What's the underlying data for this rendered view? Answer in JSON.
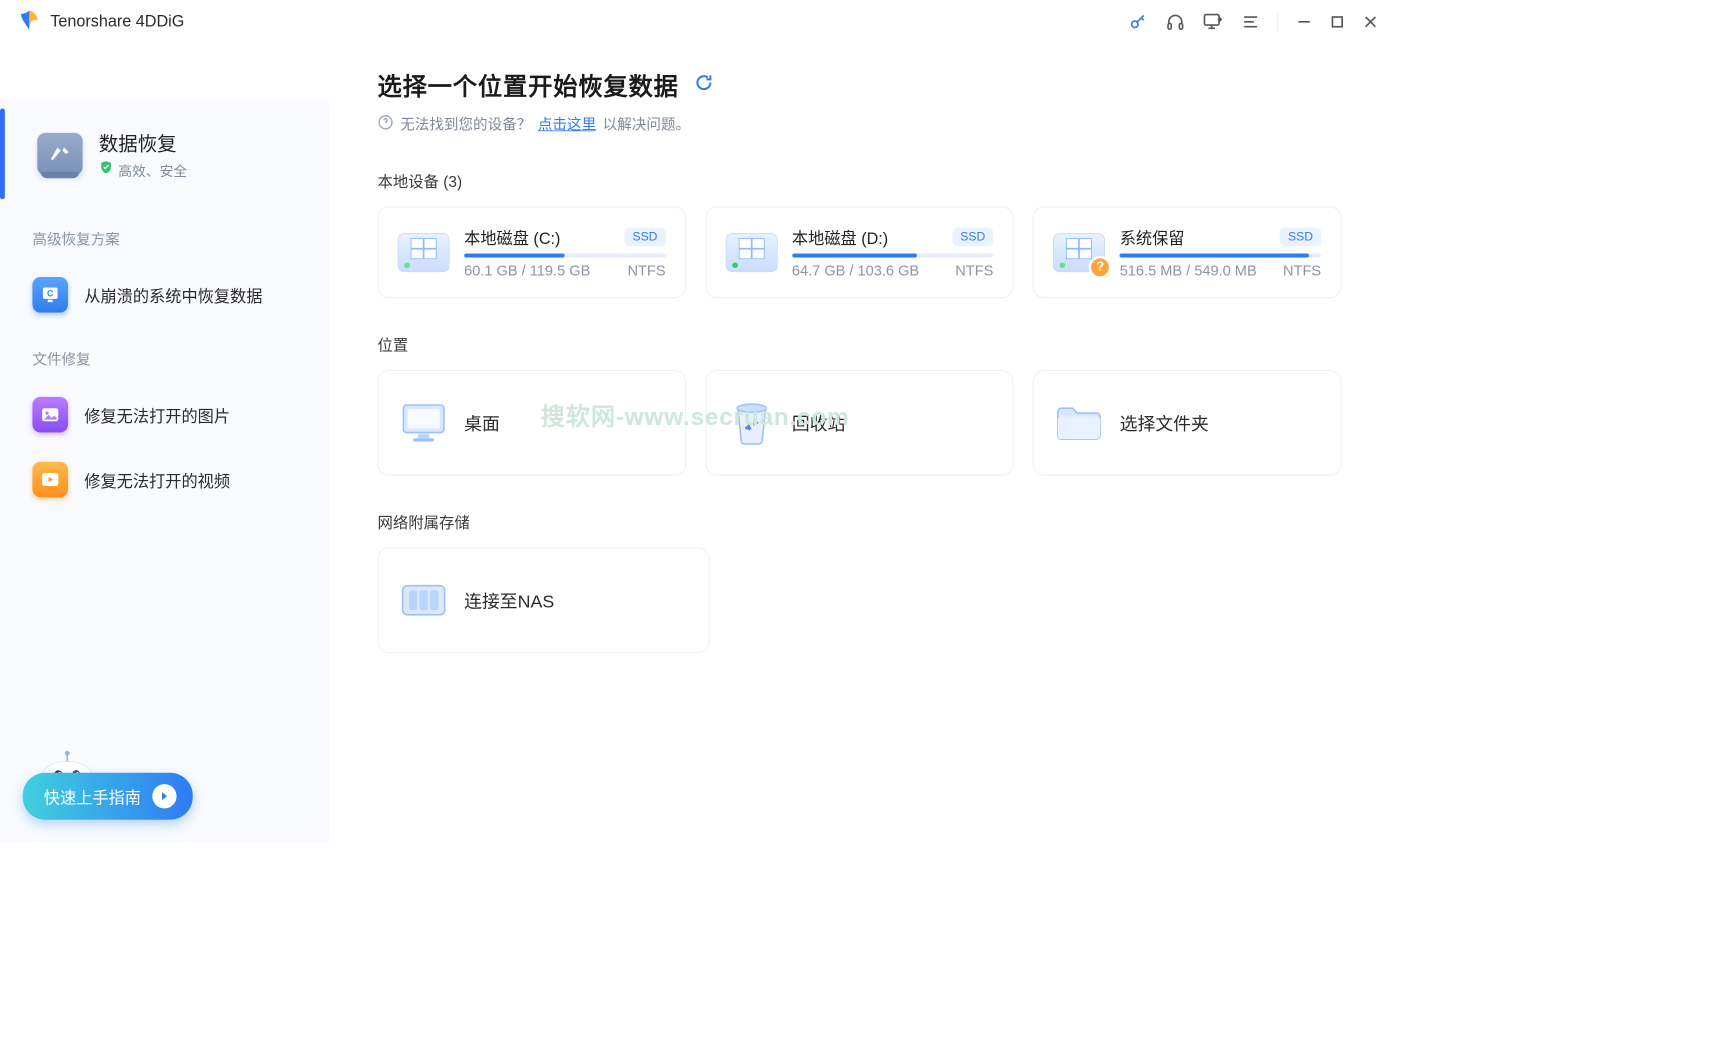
{
  "app": {
    "title": "Tenorshare 4DDiG"
  },
  "sidebar": {
    "primary": {
      "title": "数据恢复",
      "subtitle": "高效、安全"
    },
    "sections": {
      "advanced_label": "高级恢复方案",
      "crash_recovery": "从崩溃的系统中恢复数据",
      "file_repair_label": "文件修复",
      "repair_photo": "修复无法打开的图片",
      "repair_video": "修复无法打开的视频"
    },
    "guide_button": "快速上手指南"
  },
  "main": {
    "title": "选择一个位置开始恢复数据",
    "help_prefix": "无法找到您的设备？",
    "help_link": "点击这里",
    "help_suffix": "以解决问题。",
    "local_label": "本地设备 (3)",
    "disks": [
      {
        "name": "本地磁盘 (C:)",
        "badge": "SSD",
        "used_pct": 50,
        "usage": "60.1 GB / 119.5 GB",
        "fs": "NTFS",
        "warn": false
      },
      {
        "name": "本地磁盘 (D:)",
        "badge": "SSD",
        "used_pct": 62,
        "usage": "64.7 GB / 103.6 GB",
        "fs": "NTFS",
        "warn": false
      },
      {
        "name": "系统保留",
        "badge": "SSD",
        "used_pct": 94,
        "usage": "516.5 MB / 549.0 MB",
        "fs": "NTFS",
        "warn": true
      }
    ],
    "pos_label": "位置",
    "locations": {
      "desktop": "桌面",
      "recycle": "回收站",
      "choose_folder": "选择文件夹"
    },
    "nas_label": "网络附属存储",
    "nas_connect": "连接至NAS"
  },
  "watermark": "搜软网-www.secruan.com"
}
